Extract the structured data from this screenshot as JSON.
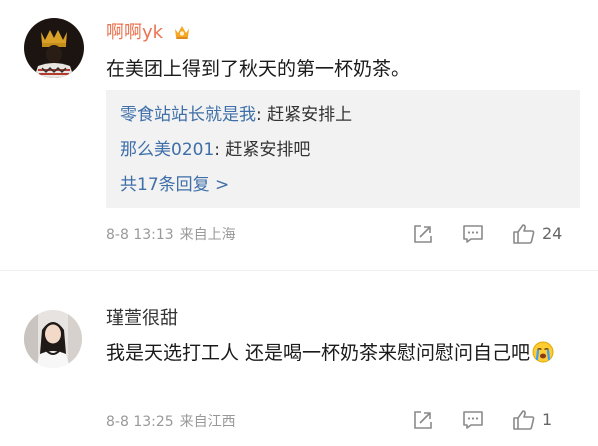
{
  "comments": [
    {
      "username": "啊啊yk",
      "has_vip_badge": true,
      "text": "在美团上得到了秋天的第一杯奶茶。",
      "replies": [
        {
          "author": "零食站站长就是我",
          "separator": ": ",
          "text": "赶紧安排上"
        },
        {
          "author": "那么美0201",
          "separator": ": ",
          "text": "赶紧安排吧"
        }
      ],
      "more_replies": "共17条回复 >",
      "date": "8-8 13:13",
      "location": "来自上海",
      "like_count": "24"
    },
    {
      "username": "瑾萱很甜",
      "text": "我是天选打工人 还是喝一杯奶茶来慰问慰问自己吧",
      "emoji": "crying-face-emoji",
      "date": "8-8 13:25",
      "location": "来自江西",
      "like_count": "1"
    }
  ],
  "colors": {
    "highlight_username": "#eb7350",
    "link_blue": "#3f6fa8",
    "meta_gray": "#999999",
    "reply_bg": "#f2f2f2"
  }
}
